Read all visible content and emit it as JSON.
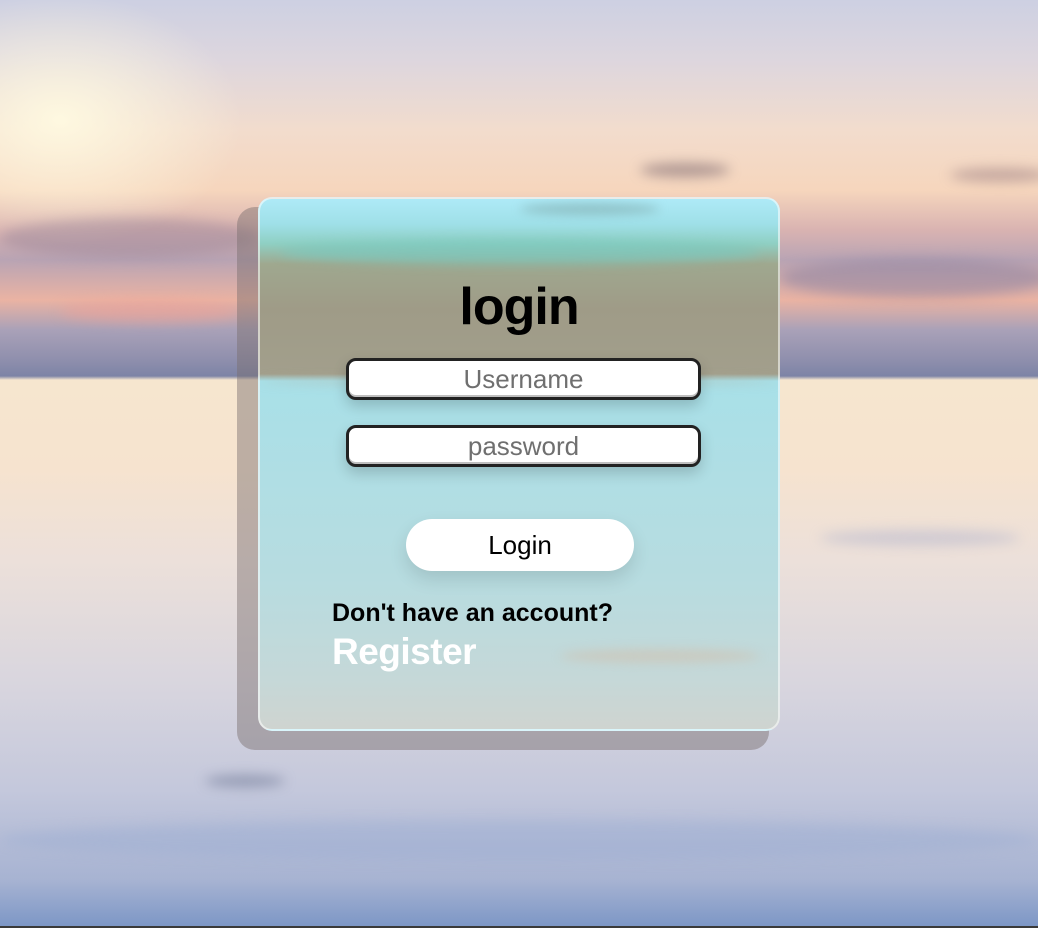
{
  "login": {
    "title": "login",
    "username_placeholder": "Username",
    "password_placeholder": "password",
    "login_button": "Login",
    "register_prompt": "Don't have an account?",
    "register_link": "Register"
  },
  "colors": {
    "register_link": "#ffffff",
    "button_background": "#ffffff",
    "card_tint": "#a8e0e8"
  }
}
